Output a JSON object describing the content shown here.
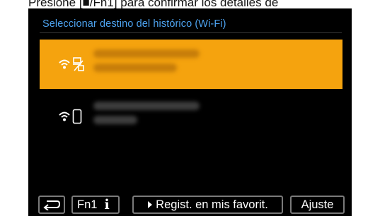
{
  "caption": "Presione [■/Fn1] para confirmar los detalles de",
  "screen": {
    "title": "Seleccionar destino del histórico (Wi-Fi)",
    "rows": [
      {
        "icon": "wifi-pc-icon",
        "selected": true
      },
      {
        "icon": "wifi-smartphone-icon",
        "selected": false
      }
    ]
  },
  "bottom": {
    "fn_label": "Fn1",
    "info_icon": "i",
    "favorites_label": "Regist. en mis favorit.",
    "settings_label": "Ajuste"
  },
  "colors": {
    "accent": "#f5a30e",
    "title": "#4da3f0",
    "background": "#000000"
  }
}
